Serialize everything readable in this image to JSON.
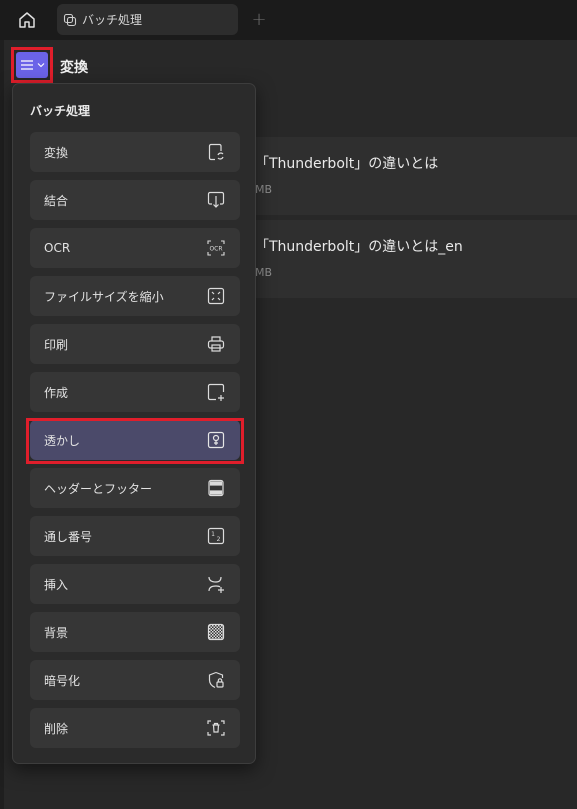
{
  "tabbar": {
    "tab_title": "バッチ処理",
    "new_tab_label": "+"
  },
  "header": {
    "title": "変換"
  },
  "files": [
    {
      "name": "「Thunderbolt」の違いとは",
      "size": "MB"
    },
    {
      "name": "「Thunderbolt」の違いとは_en",
      "size": "MB"
    }
  ],
  "menu": {
    "title": "バッチ処理",
    "items": [
      {
        "label": "変換",
        "icon": "convert-icon"
      },
      {
        "label": "結合",
        "icon": "merge-icon"
      },
      {
        "label": "OCR",
        "icon": "ocr-icon"
      },
      {
        "label": "ファイルサイズを縮小",
        "icon": "compress-icon"
      },
      {
        "label": "印刷",
        "icon": "printer-icon"
      },
      {
        "label": "作成",
        "icon": "create-icon"
      },
      {
        "label": "透かし",
        "icon": "watermark-icon"
      },
      {
        "label": "ヘッダーとフッター",
        "icon": "header-footer-icon"
      },
      {
        "label": "通し番号",
        "icon": "numbering-icon"
      },
      {
        "label": "挿入",
        "icon": "insert-icon"
      },
      {
        "label": "背景",
        "icon": "background-icon"
      },
      {
        "label": "暗号化",
        "icon": "encrypt-icon"
      },
      {
        "label": "削除",
        "icon": "delete-icon"
      }
    ],
    "selected_index": 6
  },
  "colors": {
    "accent": "#6b63e8",
    "highlight_border": "#e01e2b",
    "selected_item": "#4b4a6a"
  }
}
